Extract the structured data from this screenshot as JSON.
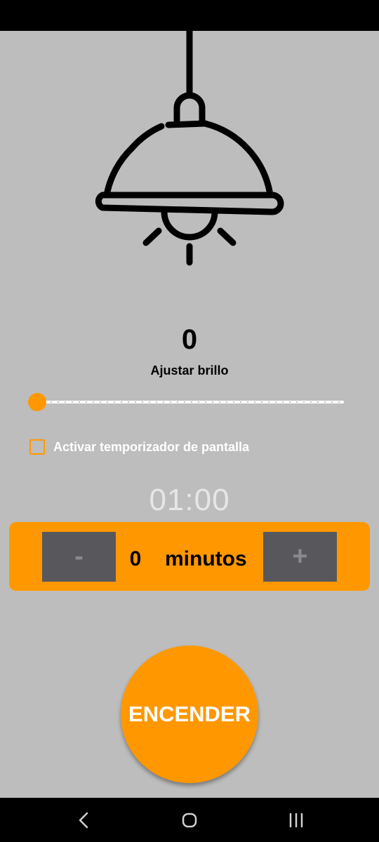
{
  "brightness": {
    "value": "0",
    "label": "Ajustar brillo",
    "slider_level": 0
  },
  "timer": {
    "checkbox_label": "Activar temporizador de pantalla",
    "checked": false,
    "display": "01:00"
  },
  "stepper": {
    "minus_label": "-",
    "value": "0",
    "unit": "minutos",
    "plus_label": "+"
  },
  "power_button": {
    "label": "ENCENDER"
  },
  "icons": {
    "lamp": "pendant-lamp-icon",
    "back": "back-icon",
    "home": "home-icon",
    "recents": "recents-icon"
  },
  "colors": {
    "accent": "#ff9800",
    "background": "#bdbdbd",
    "stepper_button": "#58585c"
  }
}
